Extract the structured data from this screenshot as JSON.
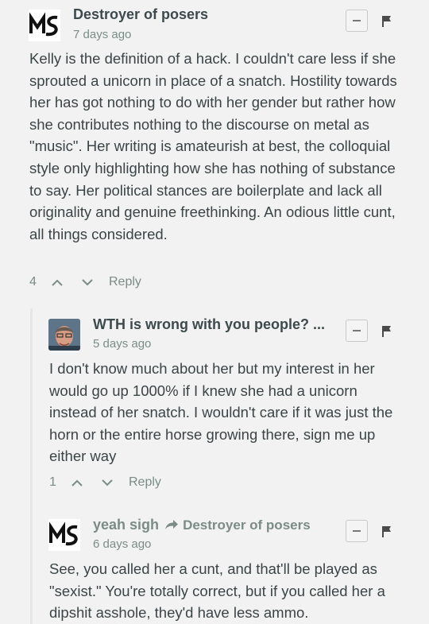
{
  "comments": [
    {
      "author": "Destroyer of posers",
      "time": "7 days ago",
      "text": "Kelly is the definition of a hack. I couldn't care less if she sprouted a unicorn in place of a snatch. Hostility towards her has got nothing to do with her gender but rather how she contributes nothing to the discourse on metal as \"music\". Her writing is amateurish at best, the colloquial style only highlighting how she has nothing of substance to say. Her political stances are boilerplate and lack all originality and genuine freethinking. An odious little cunt, all things considered.",
      "votes": "4",
      "reply_label": "Reply"
    },
    {
      "author": "WTH is wrong with you people? ...",
      "time": "5 days ago",
      "text": "I don't know much about her but my interest in her would go up 1000% if I knew she had a unicorn instead of her snatch. I wouldn't care if it was just the horn or the entire horse growing there, sign me up either way",
      "votes": "1",
      "reply_label": "Reply"
    },
    {
      "author": "yeah sigh",
      "in_reply_to": "Destroyer of posers",
      "time": "6 days ago",
      "text": "See, you called her a cunt, and that'll be played as \"sexist.\" You're totally correct, but if you called her a dipshit asshole, they'd have less ammo."
    }
  ],
  "icons": {
    "collapse": "minus-icon",
    "flag": "flag-icon",
    "upvote": "chevron-up-icon",
    "downvote": "chevron-down-icon",
    "reply_arrow": "share-arrow-icon"
  },
  "colors": {
    "background": "#f2f2f2",
    "author": "#3d4a4c",
    "muted": "#7b8c87",
    "text": "#3b4446"
  }
}
